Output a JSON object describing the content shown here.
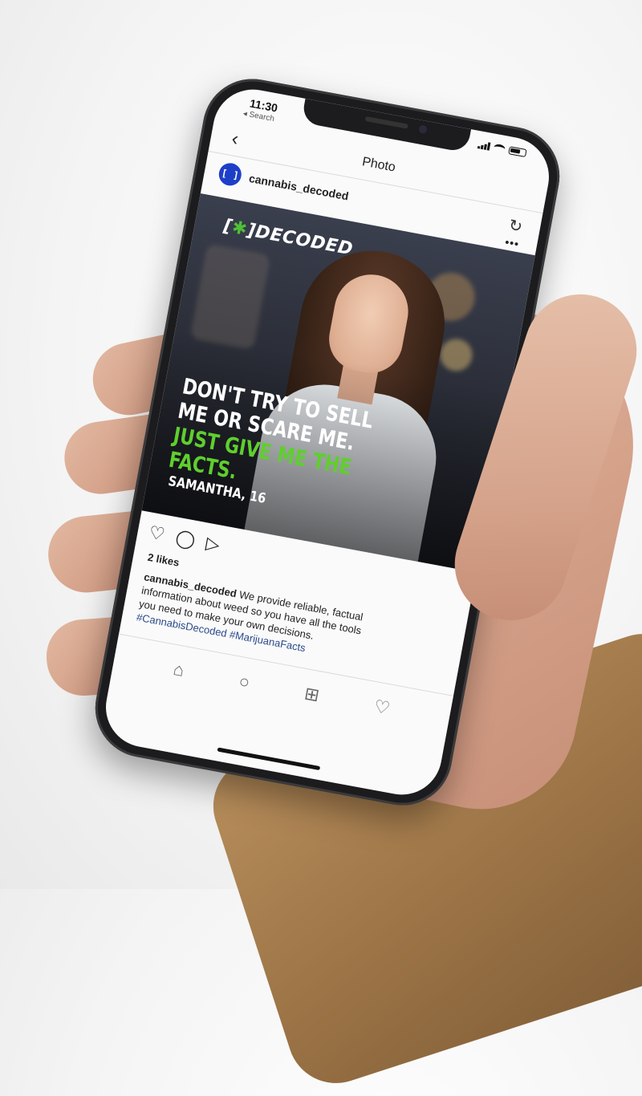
{
  "status_bar": {
    "time": "11:30",
    "back_label": "◂ Search"
  },
  "nav": {
    "title": "Photo"
  },
  "post": {
    "avatar_text": "[ ]",
    "username": "cannabis_decoded",
    "brand": "DECODED",
    "quote_part1": "DON'T TRY TO SELL ME OR SCARE ME.",
    "quote_part2": "JUST GIVE ME THE FACTS.",
    "attribution": "SAMANTHA, 16",
    "likes": "2 likes",
    "caption_user": "cannabis_decoded",
    "caption_text": "We provide reliable, factual information about weed so you have all the tools you need to make your own decisions.",
    "hashtags": "#CannabisDecoded #MarijuanaFacts"
  },
  "colors": {
    "accent_green": "#5fcf2e",
    "avatar_blue": "#1d3fc7",
    "hashtag_blue": "#2b4b8a"
  },
  "icons": {
    "back": "chevron-left-icon",
    "refresh": "refresh-icon",
    "more": "more-options-icon",
    "like": "heart-icon",
    "comment": "comment-icon",
    "share": "paper-plane-icon",
    "home": "home-icon",
    "search": "search-icon",
    "add": "add-post-icon",
    "activity": "heart-icon"
  }
}
